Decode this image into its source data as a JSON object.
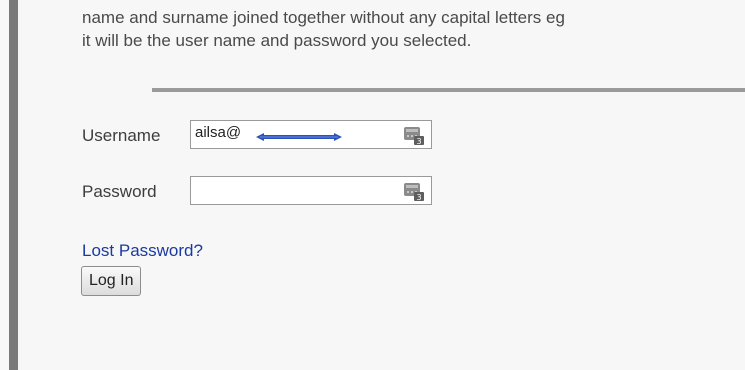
{
  "intro": {
    "line1": "name and surname joined together without any capital letters eg",
    "line2": "it will be the user name and password you selected."
  },
  "login_form": {
    "username_label": "Username",
    "username_value": "ailsa@",
    "password_label": "Password",
    "password_value": "",
    "lost_password_link": "Lost Password?",
    "login_button": "Log In"
  },
  "icons": {
    "field_icon": "password-manager-icon"
  },
  "colors": {
    "link": "#1a3aa0",
    "scribble": "#2a52b8"
  }
}
